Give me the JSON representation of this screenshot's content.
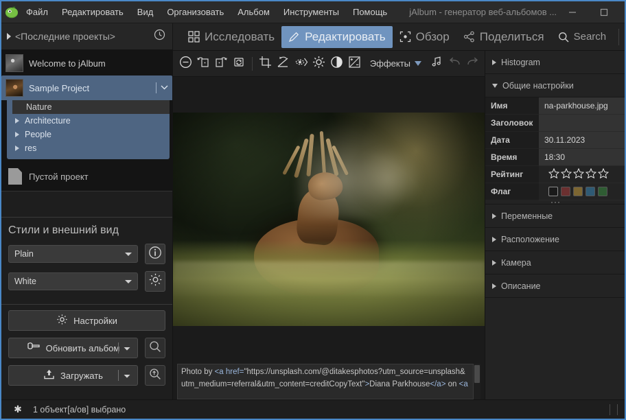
{
  "window": {
    "title": "jAlbum - генератор веб-альбомов ...",
    "minimize_label": "—",
    "maximize_label": "☐",
    "close_label": "✕"
  },
  "menu": {
    "items": [
      {
        "label": "Файл"
      },
      {
        "label": "Редактировать"
      },
      {
        "label": "Вид"
      },
      {
        "label": "Организовать"
      },
      {
        "label": "Альбом"
      },
      {
        "label": "Инструменты"
      },
      {
        "label": "Помощь"
      }
    ]
  },
  "projects_header": {
    "label": "<Последние проекты>",
    "clock_icon": "clock-icon",
    "expander_icon": "triangle-right-icon"
  },
  "tabs": [
    {
      "label": "Исследовать",
      "icon": "grid-icon",
      "active": false
    },
    {
      "label": "Редактировать",
      "icon": "pencil-icon",
      "active": true
    },
    {
      "label": "Обзор",
      "icon": "preview-frame-icon",
      "active": false
    },
    {
      "label": "Поделиться",
      "icon": "share-icon",
      "active": false
    },
    {
      "label": "Search",
      "icon": "search-icon",
      "active": false
    }
  ],
  "help_icon": "question-circle-icon",
  "sidebar": {
    "projects": [
      {
        "label": "Welcome to jAlbum",
        "selected": false
      },
      {
        "label": "Sample Project",
        "selected": true
      }
    ],
    "tree": [
      {
        "label": "Nature",
        "selected": true,
        "expandable": false
      },
      {
        "label": "Architecture",
        "selected": false,
        "expandable": true
      },
      {
        "label": "People",
        "selected": false,
        "expandable": true
      },
      {
        "label": "res",
        "selected": false,
        "expandable": true
      }
    ],
    "empty_project": {
      "label": "Пустой проект",
      "icon": "document-icon"
    },
    "styles": {
      "title": "Стили и внешний вид",
      "style_value": "Plain",
      "skin_value": "White",
      "info_icon": "info-circle-icon",
      "settings_icon": "gear-icon"
    },
    "actions": {
      "settings_label": "Настройки",
      "settings_icon": "gear-icon",
      "make_album_label": "Обновить альбом",
      "make_album_icon": "hammer-icon",
      "upload_label": "Загружать",
      "upload_icon": "upload-icon",
      "preview_icon": "magnifier-icon",
      "preview_online_icon": "magnifier-up-icon",
      "dropdown_arrow": "chevron-down-icon"
    }
  },
  "editor": {
    "toolbar": [
      {
        "name": "remove-button",
        "icon": "minus-circle-icon"
      },
      {
        "name": "rotate-left-button",
        "icon": "rotate-left-icon"
      },
      {
        "name": "rotate-right-button",
        "icon": "rotate-right-icon"
      },
      {
        "name": "reload-button",
        "icon": "refresh-image-icon"
      },
      {
        "name": "crop-button",
        "icon": "crop-icon"
      },
      {
        "name": "straighten-button",
        "icon": "straighten-icon"
      },
      {
        "name": "red-eye-button",
        "icon": "red-eye-icon"
      },
      {
        "name": "brightness-button",
        "icon": "sun-icon"
      },
      {
        "name": "contrast-button",
        "icon": "contrast-icon"
      },
      {
        "name": "levels-button",
        "icon": "levels-icon"
      }
    ],
    "effects_label": "Эффекты",
    "effects_arrow": "triangle-down-icon",
    "audio_icon": "music-note-icon",
    "undo_icon": "undo-arrow-icon",
    "redo_icon": "redo-arrow-icon",
    "image_alt": "Red deer resting in misty field at sunrise"
  },
  "caption": {
    "text_parts": [
      {
        "t": "Photo by ",
        "k": "plain"
      },
      {
        "t": "<a href=",
        "k": "tag"
      },
      {
        "t": "\"https://unsplash.com/@ditakesphotos?utm_source=unsplash&utm_medium=referral&utm_content=creditCopyText\"",
        "k": "plain"
      },
      {
        "t": ">",
        "k": "tag"
      },
      {
        "t": "Diana Parkhouse",
        "k": "plain"
      },
      {
        "t": "</a>",
        "k": "tag"
      },
      {
        "t": " on ",
        "k": "plain"
      },
      {
        "t": "<a",
        "k": "tag"
      }
    ],
    "full_text": "Photo by <a href=\"https://unsplash.com/@ditakesphotos?utm_source=unsplash&utm_medium=referral&utm_content=creditCopyText\">Diana Parkhouse</a> on <a"
  },
  "rightpanel": {
    "sections": [
      {
        "label": "Histogram",
        "expanded": false
      },
      {
        "label": "Общие настройки",
        "expanded": true
      },
      {
        "label": "Переменные",
        "expanded": false
      },
      {
        "label": "Расположение",
        "expanded": false
      },
      {
        "label": "Камера",
        "expanded": false
      },
      {
        "label": "Описание",
        "expanded": false
      }
    ],
    "general": {
      "rows": [
        {
          "key": "Имя",
          "value": "na-parkhouse.jpg",
          "type": "text"
        },
        {
          "key": "Заголовок",
          "value": "",
          "type": "text"
        },
        {
          "key": "Дата",
          "value": "30.11.2023",
          "type": "text"
        },
        {
          "key": "Время",
          "value": "18:30",
          "type": "text"
        },
        {
          "key": "Рейтинг",
          "value": "0",
          "type": "stars",
          "max_stars": 5
        },
        {
          "key": "Флаг",
          "value": "none",
          "type": "flags"
        }
      ],
      "flag_colors": [
        "#1a1a1a",
        "#6b3030",
        "#7c6632",
        "#2f5a74",
        "#2f5c33"
      ]
    }
  },
  "statusbar": {
    "modified_icon": "asterisk-icon",
    "text": "1 объект[а/ов] выбрано"
  },
  "theme": {
    "accent": "#7094bf",
    "window_border": "#4a88c7",
    "panel_bg": "#232323",
    "sidebar_bg": "#1e1e1e",
    "tree_selection": "#4e6582"
  }
}
